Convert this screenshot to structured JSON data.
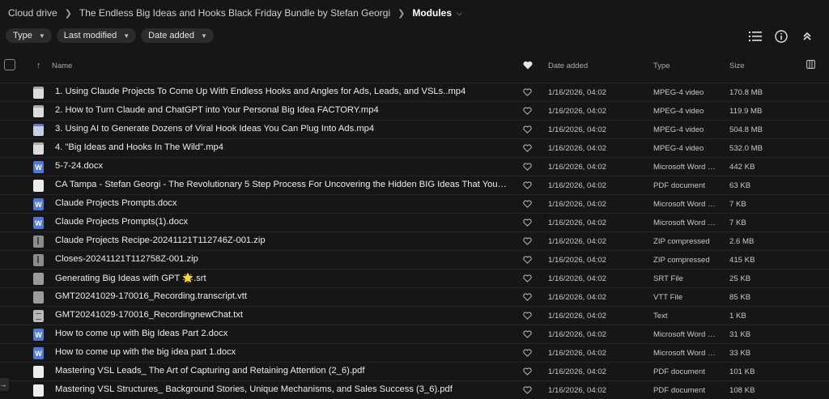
{
  "breadcrumb": {
    "items": [
      "Cloud drive",
      "The Endless Big Ideas and Hooks Black Friday Bundle by Stefan Georgi"
    ],
    "current": "Modules"
  },
  "filters": [
    "Type",
    "Last modified",
    "Date added"
  ],
  "toolbar": {
    "list_view_icon": "list-view-icon",
    "info_icon": "info-icon",
    "collapse_icon": "chevron-double-up-icon"
  },
  "table": {
    "headers": {
      "name": "Name",
      "date_added": "Date added",
      "type": "Type",
      "size": "Size"
    },
    "rows": [
      {
        "icon": "video",
        "name": "1. Using Claude Projects To Come Up With Endless Hooks and Angles for Ads, Leads, and VSLs..mp4",
        "date": "1/16/2026, 04:02",
        "type": "MPEG-4 video",
        "size": "170.8 MB"
      },
      {
        "icon": "video",
        "name": "2. How to Turn Claude and ChatGPT into Your Personal Big Idea FACTORY.mp4",
        "date": "1/16/2026, 04:02",
        "type": "MPEG-4 video",
        "size": "119.9 MB"
      },
      {
        "icon": "video-blue",
        "name": "3. Using AI to Generate Dozens of Viral Hook Ideas You Can Plug Into Ads.mp4",
        "date": "1/16/2026, 04:02",
        "type": "MPEG-4 video",
        "size": "504.8 MB"
      },
      {
        "icon": "video",
        "name": "4. \"Big Ideas and Hooks In The Wild\".mp4",
        "date": "1/16/2026, 04:02",
        "type": "MPEG-4 video",
        "size": "532.0 MB"
      },
      {
        "icon": "word",
        "name": "5-7-24.docx",
        "date": "1/16/2026, 04:02",
        "type": "Microsoft Word d...",
        "size": "442 KB"
      },
      {
        "icon": "pdf",
        "name": "CA Tampa - Stefan Georgi - The Revolutionary 5 Step Process For Uncovering the Hidden BIG Ideas That Your Mar...",
        "date": "1/16/2026, 04:02",
        "type": "PDF document",
        "size": "63 KB"
      },
      {
        "icon": "word",
        "name": "Claude Projects Prompts.docx",
        "date": "1/16/2026, 04:02",
        "type": "Microsoft Word d...",
        "size": "7 KB"
      },
      {
        "icon": "word",
        "name": "Claude Projects Prompts(1).docx",
        "date": "1/16/2026, 04:02",
        "type": "Microsoft Word d...",
        "size": "7 KB"
      },
      {
        "icon": "zip",
        "name": "Claude Projects Recipe-20241121T112746Z-001.zip",
        "date": "1/16/2026, 04:02",
        "type": "ZIP compressed",
        "size": "2.6 MB"
      },
      {
        "icon": "zip",
        "name": "Closes-20241121T112758Z-001.zip",
        "date": "1/16/2026, 04:02",
        "type": "ZIP compressed",
        "size": "415 KB"
      },
      {
        "icon": "srt",
        "name": "Generating Big Ideas with GPT 🌟.srt",
        "date": "1/16/2026, 04:02",
        "type": "SRT File",
        "size": "25 KB"
      },
      {
        "icon": "srt",
        "name": "GMT20241029-170016_Recording.transcript.vtt",
        "date": "1/16/2026, 04:02",
        "type": "VTT File",
        "size": "85 KB"
      },
      {
        "icon": "txt",
        "name": "GMT20241029-170016_RecordingnewChat.txt",
        "date": "1/16/2026, 04:02",
        "type": "Text",
        "size": "1 KB"
      },
      {
        "icon": "word",
        "name": "How to come up with Big Ideas Part 2.docx",
        "date": "1/16/2026, 04:02",
        "type": "Microsoft Word d...",
        "size": "31 KB"
      },
      {
        "icon": "word",
        "name": "How to come up with the big idea part 1.docx",
        "date": "1/16/2026, 04:02",
        "type": "Microsoft Word d...",
        "size": "33 KB"
      },
      {
        "icon": "pdf",
        "name": "Mastering VSL Leads_ The Art of Capturing and Retaining Attention (2_6).pdf",
        "date": "1/16/2026, 04:02",
        "type": "PDF document",
        "size": "101 KB"
      },
      {
        "icon": "pdf",
        "name": "Mastering VSL Structures_ Background Stories, Unique Mechanisms, and Sales Success (3_6).pdf",
        "date": "1/16/2026, 04:02",
        "type": "PDF document",
        "size": "108 KB"
      }
    ]
  }
}
